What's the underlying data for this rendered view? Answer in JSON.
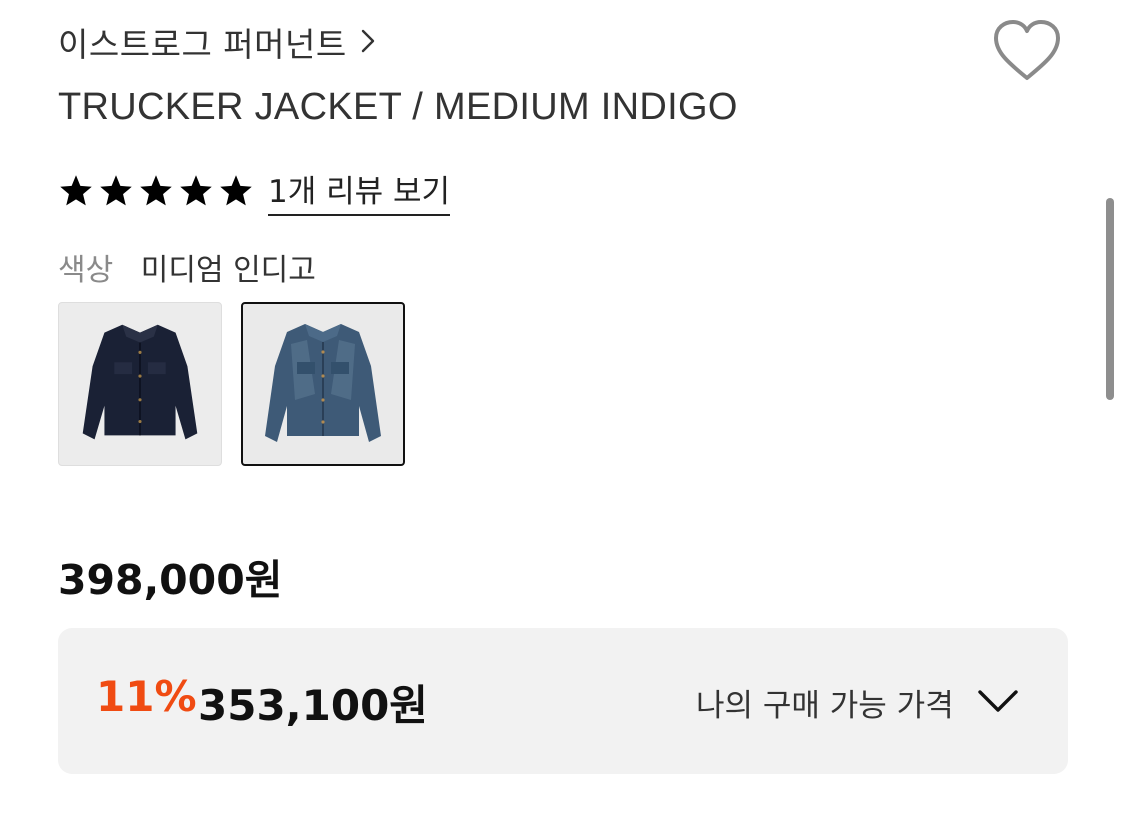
{
  "brand": {
    "name": "이스트로그 퍼머넌트"
  },
  "product": {
    "title": "TRUCKER JACKET / MEDIUM INDIGO"
  },
  "rating": {
    "stars": 5,
    "review_link": "1개 리뷰 보기"
  },
  "color": {
    "label": "색상",
    "value": "미디엄 인디고",
    "swatches": [
      {
        "name": "dark-indigo",
        "selected": false
      },
      {
        "name": "medium-indigo",
        "selected": true
      }
    ]
  },
  "price": {
    "original": "398,000원",
    "discount_percent": "11%",
    "sale_price": "353,100원",
    "my_price_label": "나의 구매 가능 가격"
  },
  "icons": {
    "brand_chevron": "chevron-right-icon",
    "wishlist": "heart-outline-icon",
    "star": "star-icon",
    "expand": "chevron-down-icon"
  },
  "colors": {
    "discount": "#f04b12",
    "text": "#111111",
    "muted": "#8a8a8a",
    "box": "#f2f2f2",
    "star": "#000000"
  }
}
